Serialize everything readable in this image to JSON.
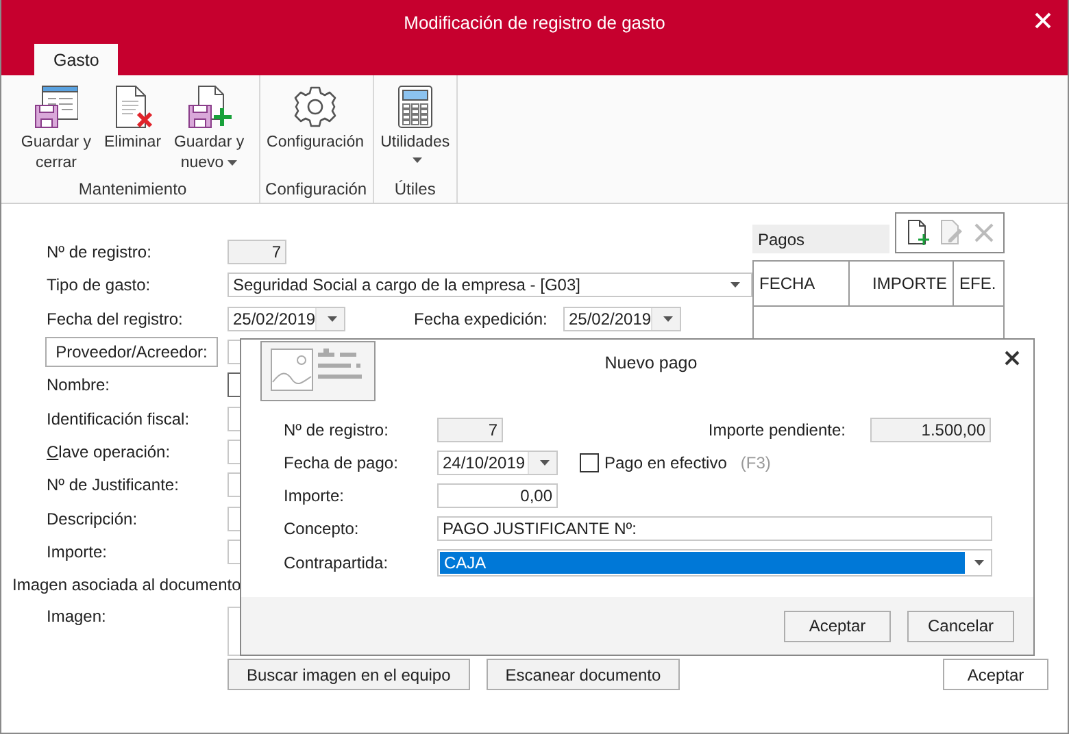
{
  "window": {
    "title": "Modificación de registro de gasto"
  },
  "tabs": [
    {
      "label": "Gasto",
      "selected": true
    }
  ],
  "ribbon": {
    "groups": [
      {
        "label": "Mantenimiento",
        "buttons": [
          {
            "kind": "save-close",
            "label": "Guardar y cerrar",
            "dropdown": false
          },
          {
            "kind": "delete",
            "label": "Eliminar",
            "dropdown": false
          },
          {
            "kind": "save-new",
            "label": "Guardar y nuevo",
            "dropdown": true
          }
        ]
      },
      {
        "label": "Configuración",
        "buttons": [
          {
            "kind": "gear",
            "label": "Configuración",
            "dropdown": false
          }
        ]
      },
      {
        "label": "Útiles",
        "buttons": [
          {
            "kind": "calculator",
            "label": "Utilidades",
            "dropdown": true
          }
        ]
      }
    ]
  },
  "form": {
    "rows": [
      {
        "kind": "readonly",
        "label": "Nº de registro:",
        "value": "7"
      },
      {
        "kind": "combo",
        "label": "Tipo de gasto:",
        "value": "Seguridad Social a cargo de la empresa - [G03]"
      },
      {
        "kind": "dates",
        "label": "Fecha del registro:",
        "value": "25/02/2019",
        "label_2": "Fecha expedición:",
        "value_2": "25/02/2019"
      },
      {
        "kind": "button",
        "label": "Proveedor/Acreedor:"
      },
      {
        "kind": "text",
        "label": "Nombre:"
      },
      {
        "kind": "text",
        "label": "Identificación fiscal:"
      },
      {
        "kind": "text",
        "label": "Clave operación:"
      },
      {
        "kind": "text",
        "label": "Nº de Justificante:"
      },
      {
        "kind": "text",
        "label": "Descripción:"
      },
      {
        "kind": "text",
        "label": "Importe:"
      },
      {
        "kind": "heading",
        "label": "Imagen asociada al documento"
      },
      {
        "kind": "image",
        "label": "Imagen:"
      }
    ],
    "buttons": [
      "Buscar imagen en el equipo",
      "Escanear documento"
    ],
    "ok": "Aceptar"
  },
  "pagos": {
    "title": "Pagos",
    "toolbar": [
      {
        "kind": "new",
        "disabled": false
      },
      {
        "kind": "edit",
        "disabled": true
      },
      {
        "kind": "delete",
        "disabled": true
      }
    ],
    "columns": [
      "FECHA",
      "IMPORTE",
      "EFE."
    ]
  },
  "dialog": {
    "title": "Nuevo pago",
    "registro": {
      "label": "Nº de registro:",
      "value": "7"
    },
    "pendiente": {
      "label": "Importe pendiente:",
      "value": "1.500,00"
    },
    "fecha": {
      "label": "Fecha de pago:",
      "value": "24/10/2019"
    },
    "efectivo": {
      "label": "Pago en efectivo",
      "hint": "(F3)",
      "checked": false
    },
    "importe": {
      "label": "Importe:",
      "value": "0,00"
    },
    "concepto": {
      "label": "Concepto:",
      "value": "PAGO JUSTIFICANTE Nº:"
    },
    "contrapartida": {
      "label": "Contrapartida:",
      "value": "CAJA",
      "selected": true
    },
    "buttons": [
      "Aceptar",
      "Cancelar"
    ]
  }
}
